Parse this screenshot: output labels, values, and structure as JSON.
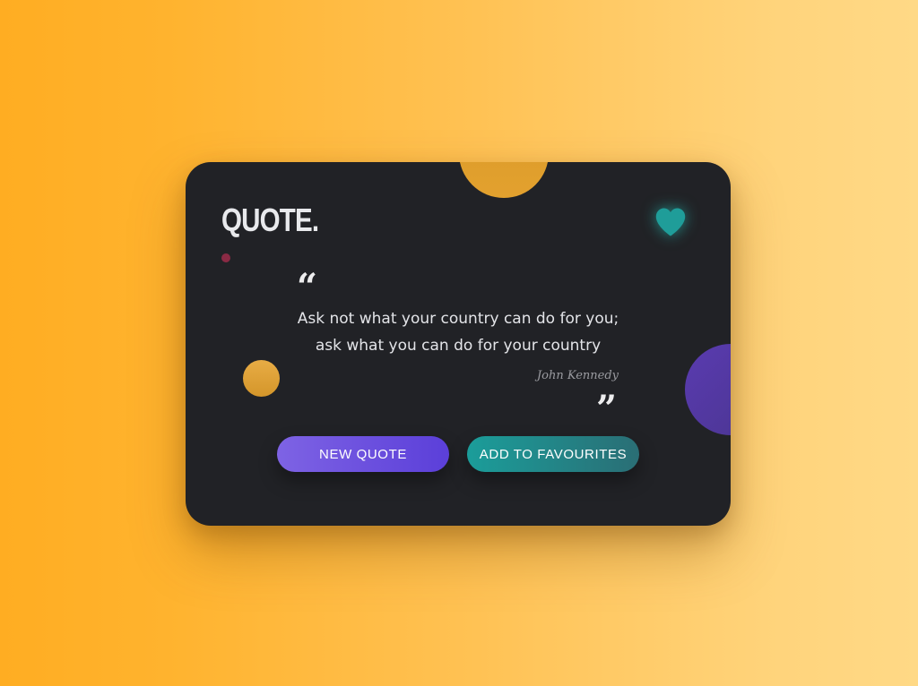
{
  "logo": "QUOTE.",
  "quote": {
    "line1": "Ask not what your country can do for you;",
    "line2": "ask what you can do for your country",
    "author": "John Kennedy",
    "open_mark": "“",
    "close_mark": "”"
  },
  "buttons": {
    "new_quote": "NEW QUOTE",
    "add_favourites": "ADD TO FAVOURITES"
  },
  "icons": {
    "favourite": "heart-icon"
  },
  "colors": {
    "background_start": "#ffad22",
    "background_end": "#ffd986",
    "card": "#212226",
    "accent_teal": "#1b9d9a",
    "accent_purple": "#6b4fdf",
    "accent_gold": "#e3a12e"
  }
}
